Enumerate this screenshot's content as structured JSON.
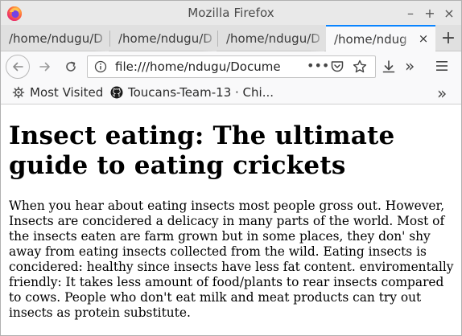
{
  "window": {
    "title": "Mozilla Firefox",
    "controls": {
      "minimize": "–",
      "maximize": "+",
      "close": "×"
    }
  },
  "tabs": [
    {
      "label": "/home/ndugu/D",
      "active": false
    },
    {
      "label": "/home/ndugu/D",
      "active": false
    },
    {
      "label": "/home/ndugu/D",
      "active": false
    },
    {
      "label": "/home/ndugu",
      "active": true
    }
  ],
  "toolbar": {
    "url": "file:///home/ndugu/Docume",
    "page_actions": "•••",
    "overflow": "»"
  },
  "bookmarks": {
    "items": [
      {
        "label": "Most Visited",
        "icon": "gear-icon"
      },
      {
        "label": "Toucans-Team-13 · Chi...",
        "icon": "github-icon"
      }
    ],
    "overflow": "»"
  },
  "page": {
    "heading": "Insect eating: The ultimate guide to eating crickets",
    "paragraph": "When you hear about eating insects most people gross out. However, Insects are concidered a delicacy in many parts of the world. Most of the insects eaten are farm grown but in some places, they don' shy away from eating insects collected from the wild. Eating insects is concidered: healthy since insects have less fat content. enviromentally friendly: It takes less amount of food/plants to rear insects compared to cows. People who don't eat milk and meat products can try out insects as protein substitute."
  },
  "colors": {
    "accent": "#0a84ff",
    "titlebar": "#e9e9e9",
    "tabstrip": "#e0e0e0",
    "toolbar": "#f9f9fa"
  }
}
